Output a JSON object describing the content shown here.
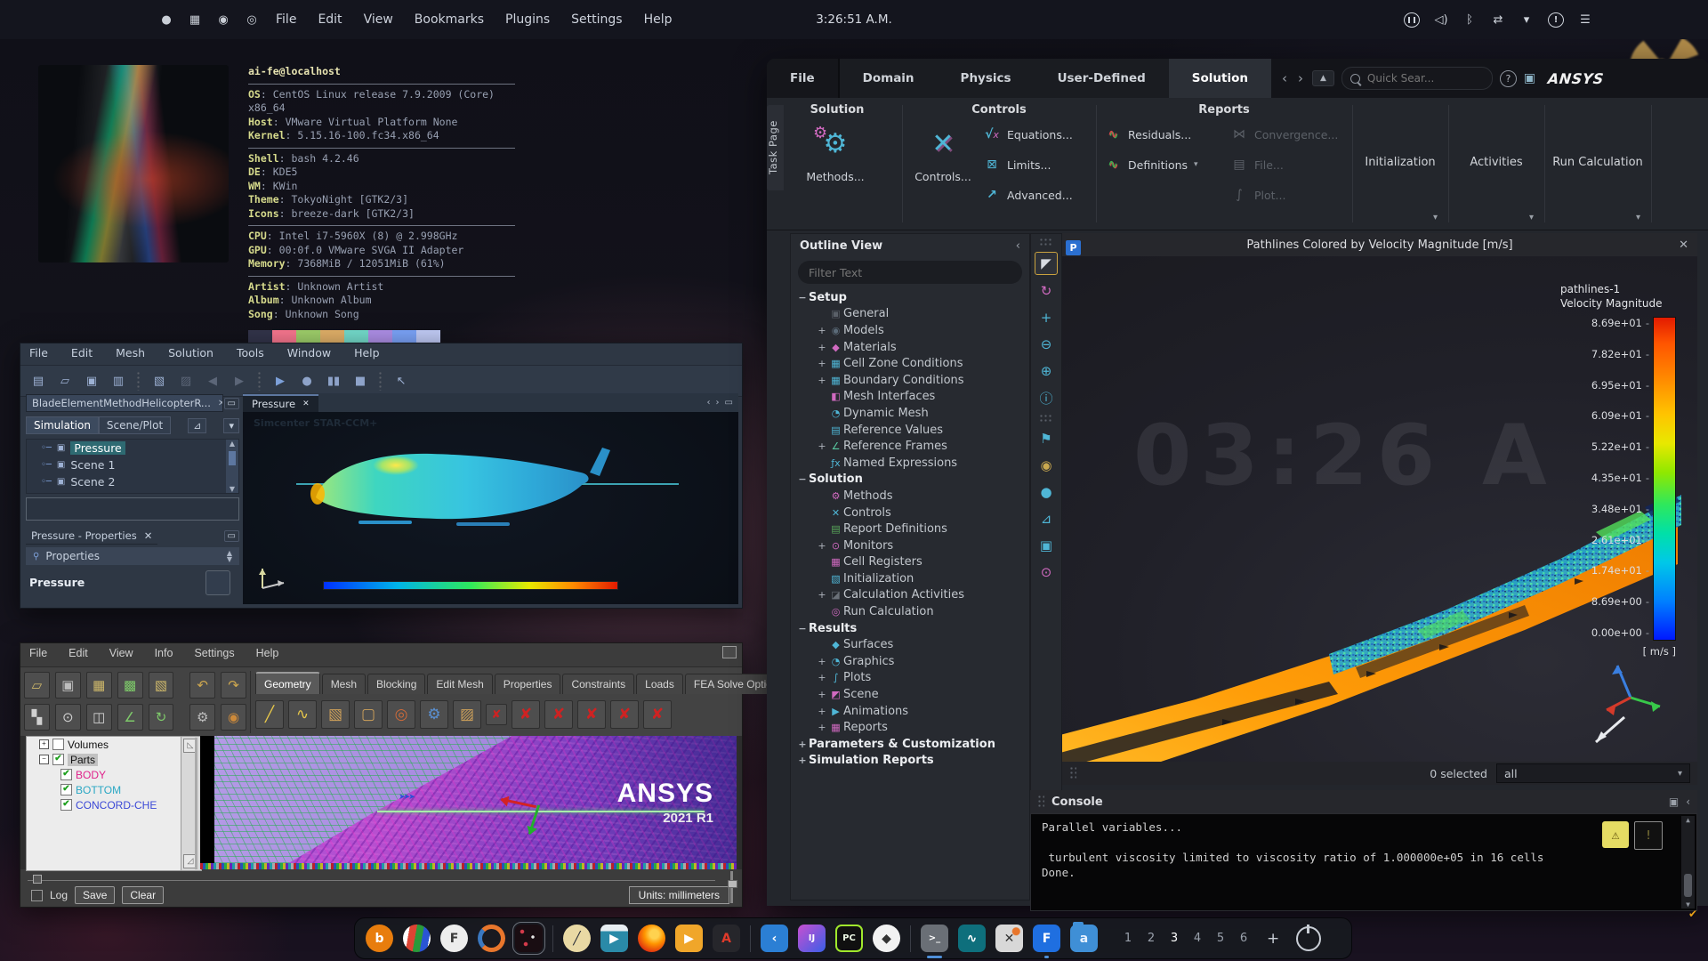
{
  "menubar": {
    "launchers": [
      {
        "n": "launcher-apps-icon",
        "g": "●"
      },
      {
        "n": "launcher-widgets-icon",
        "g": "▦"
      },
      {
        "n": "launcher-browser-icon",
        "g": "◉"
      },
      {
        "n": "launcher-settings-icon",
        "g": "◎"
      }
    ],
    "menus": [
      "File",
      "Edit",
      "View",
      "Bookmarks",
      "Plugins",
      "Settings",
      "Help"
    ],
    "time": "3:26:51 A.M.",
    "tray": [
      {
        "n": "media-pause-icon",
        "g": "",
        "cls": "tray-pause"
      },
      {
        "n": "volume-icon",
        "g": "◁)",
        "cls": ""
      },
      {
        "n": "bluetooth-icon",
        "g": "ᛒ",
        "cls": ""
      },
      {
        "n": "network-link-icon",
        "g": "⇄",
        "cls": ""
      },
      {
        "n": "tray-expand-icon",
        "g": "▾",
        "cls": ""
      },
      {
        "n": "notifications-icon",
        "g": "!",
        "cls": "tray-alert"
      },
      {
        "n": "panel-menu-icon",
        "g": "☰",
        "cls": ""
      }
    ]
  },
  "neofetch": {
    "host": "ai-fe@localhost",
    "groups": [
      [
        {
          "label": "OS",
          "value": "CentOS Linux release 7.9.2009 (Core) x86_64"
        },
        {
          "label": "Host",
          "value": "VMware Virtual Platform None"
        },
        {
          "label": "Kernel",
          "value": "5.15.16-100.fc34.x86_64"
        }
      ],
      [
        {
          "label": "Shell",
          "value": "bash 4.2.46"
        },
        {
          "label": "DE",
          "value": "KDE5"
        },
        {
          "label": "WM",
          "value": "KWin"
        },
        {
          "label": "Theme",
          "value": "TokyoNight [GTK2/3]"
        },
        {
          "label": "Icons",
          "value": "breeze-dark [GTK2/3]"
        }
      ],
      [
        {
          "label": "CPU",
          "value": "Intel i7-5960X (8) @ 2.998GHz"
        },
        {
          "label": "GPU",
          "value": "00:0f.0 VMware SVGA II Adapter"
        },
        {
          "label": "Memory",
          "value": "7368MiB / 12051MiB (61%)"
        }
      ],
      [
        {
          "label": "Artist",
          "value": "Unknown Artist"
        },
        {
          "label": "Album",
          "value": "Unknown Album"
        },
        {
          "label": "Song",
          "value": "Unknown Song"
        }
      ]
    ],
    "palette": [
      "#32344a",
      "#f7768e",
      "#9ece6a",
      "#e0af68",
      "#73daca",
      "#ad8ee6",
      "#7aa2f7",
      "#c0caf5"
    ]
  },
  "fluent": {
    "task_page": "Task Page",
    "tabs": [
      "File",
      "Domain",
      "Physics",
      "User-Defined",
      "Solution"
    ],
    "active_tab": "Solution",
    "search_placeholder": "Quick Sear...",
    "logo": "ANSYS",
    "ribbon": {
      "solution_title": "Solution",
      "methods": "Methods...",
      "controls_title": "Controls",
      "controls_big": "Controls...",
      "equations": "Equations...",
      "limits": "Limits...",
      "advanced": "Advanced...",
      "reports_title": "Reports",
      "residuals": "Residuals...",
      "definitions": "Definitions",
      "convergence": "Convergence...",
      "file": "File...",
      "plot": "Plot...",
      "init_group": "Initialization",
      "activities_group": "Activities",
      "run_group": "Run Calculation"
    },
    "outline": {
      "title": "Outline View",
      "filter_placeholder": "Filter Text",
      "items": [
        {
          "t": "Setup",
          "d": 0,
          "bold": true,
          "exp": "−"
        },
        {
          "t": "General",
          "d": 1,
          "icon": {
            "g": "▣",
            "c": "#5a6068"
          }
        },
        {
          "t": "Models",
          "d": 1,
          "exp": "+",
          "icon": {
            "g": "◉",
            "c": "#5a6a78"
          }
        },
        {
          "t": "Materials",
          "d": 1,
          "exp": "+",
          "icon": {
            "g": "◆",
            "c": "#d06ac0"
          }
        },
        {
          "t": "Cell Zone Conditions",
          "d": 1,
          "exp": "+",
          "icon": {
            "g": "▦",
            "c": "#4fb6d6"
          }
        },
        {
          "t": "Boundary Conditions",
          "d": 1,
          "exp": "+",
          "icon": {
            "g": "▦",
            "c": "#4fb6d6"
          }
        },
        {
          "t": "Mesh Interfaces",
          "d": 1,
          "icon": {
            "g": "◧",
            "c": "#d06ac0"
          }
        },
        {
          "t": "Dynamic Mesh",
          "d": 1,
          "icon": {
            "g": "◔",
            "c": "#4fb6d6"
          }
        },
        {
          "t": "Reference Values",
          "d": 1,
          "icon": {
            "g": "▤",
            "c": "#4fb6d6"
          }
        },
        {
          "t": "Reference Frames",
          "d": 1,
          "exp": "+",
          "icon": {
            "g": "∠",
            "c": "#58c8a0"
          }
        },
        {
          "t": "Named Expressions",
          "d": 1,
          "icon": {
            "g": "ƒx",
            "c": "#4fb6d6"
          }
        },
        {
          "t": "Solution",
          "d": 0,
          "bold": true,
          "exp": "−"
        },
        {
          "t": "Methods",
          "d": 1,
          "icon": {
            "g": "⚙",
            "c": "#d06ac0"
          }
        },
        {
          "t": "Controls",
          "d": 1,
          "icon": {
            "g": "✕",
            "c": "#4fb6d6"
          }
        },
        {
          "t": "Report Definitions",
          "d": 1,
          "icon": {
            "g": "▤",
            "c": "#58a85a"
          }
        },
        {
          "t": "Monitors",
          "d": 1,
          "exp": "+",
          "icon": {
            "g": "⊙",
            "c": "#d06ac0"
          }
        },
        {
          "t": "Cell Registers",
          "d": 1,
          "icon": {
            "g": "▦",
            "c": "#d06ac0"
          }
        },
        {
          "t": "Initialization",
          "d": 1,
          "icon": {
            "g": "▧",
            "c": "#4fb6d6"
          }
        },
        {
          "t": "Calculation Activities",
          "d": 1,
          "exp": "+",
          "icon": {
            "g": "◪",
            "c": "#6a7078"
          }
        },
        {
          "t": "Run Calculation",
          "d": 1,
          "icon": {
            "g": "◎",
            "c": "#d06ac0"
          }
        },
        {
          "t": "Results",
          "d": 0,
          "bold": true,
          "exp": "−"
        },
        {
          "t": "Surfaces",
          "d": 1,
          "icon": {
            "g": "◆",
            "c": "#4fb6d6"
          }
        },
        {
          "t": "Graphics",
          "d": 1,
          "exp": "+",
          "icon": {
            "g": "◔",
            "c": "#4fb6d6"
          }
        },
        {
          "t": "Plots",
          "d": 1,
          "exp": "+",
          "icon": {
            "g": "∫",
            "c": "#4fb6d6"
          }
        },
        {
          "t": "Scene",
          "d": 1,
          "exp": "+",
          "icon": {
            "g": "◩",
            "c": "#d06ac0"
          }
        },
        {
          "t": "Animations",
          "d": 1,
          "exp": "+",
          "icon": {
            "g": "▶",
            "c": "#4fb6d6"
          }
        },
        {
          "t": "Reports",
          "d": 1,
          "exp": "+",
          "icon": {
            "g": "▦",
            "c": "#d06ac0"
          }
        },
        {
          "t": "Parameters & Customization",
          "d": 0,
          "bold": true,
          "exp": "+"
        },
        {
          "t": "Simulation Reports",
          "d": 0,
          "bold": true,
          "exp": "+"
        }
      ]
    },
    "view_toolbar": [
      {
        "n": "select-pointer-tool",
        "g": "◤",
        "c": "#d8dce2",
        "sel": true
      },
      {
        "n": "rotate-view-tool",
        "g": "↻",
        "c": "#d06ac0"
      },
      {
        "n": "pan-tool",
        "g": "+",
        "c": "#4fb6d6"
      },
      {
        "n": "zoom-out-tool",
        "g": "⊖",
        "c": "#4fb6d6"
      },
      {
        "n": "zoom-in-tool",
        "g": "⊕",
        "c": "#4fb6d6"
      },
      {
        "n": "probe-info-tool",
        "g": "ⓘ",
        "c": "#4fb6d6"
      },
      {
        "n": "annotate-flag-tool",
        "g": "⚑",
        "c": "#4fb6d6"
      },
      {
        "n": "lights-tool",
        "g": "◉",
        "c": "#c9a84f"
      },
      {
        "n": "view-sphere-tool",
        "g": "●",
        "c": "#4fb6d6"
      },
      {
        "n": "axes-tool",
        "g": "⊿",
        "c": "#4fb6d6"
      },
      {
        "n": "copy-view-tool",
        "g": "▣",
        "c": "#4fb6d6"
      },
      {
        "n": "visibility-tool",
        "g": "⊙",
        "c": "#d06ac0"
      }
    ],
    "viewport": {
      "title": "Pathlines Colored by Velocity Magnitude [m/s]",
      "clock_watermark": "03:26 A",
      "p_badge": "P",
      "legend_name": "pathlines-1",
      "legend_title": "Velocity Magnitude",
      "legend_unit": "[ m/s ]",
      "ticks": [
        "8.69e+01",
        "7.82e+01",
        "6.95e+01",
        "6.09e+01",
        "5.22e+01",
        "4.35e+01",
        "3.48e+01",
        "2.61e+01",
        "1.74e+01",
        "8.69e+00",
        "0.00e+00"
      ],
      "selected": "0 selected",
      "scope": "all"
    },
    "console": {
      "title": "Console",
      "lines": [
        "Parallel variables...",
        "",
        " turbulent viscosity limited to viscosity ratio of 1.000000e+05 in 16 cells",
        "Done."
      ]
    }
  },
  "star": {
    "menus": [
      "File",
      "Edit",
      "Mesh",
      "Solution",
      "Tools",
      "Window",
      "Help"
    ],
    "toolbar": [
      {
        "n": "new-simulation",
        "g": "▤",
        "c": "#9db1d4"
      },
      {
        "n": "open-simulation",
        "g": "▱",
        "c": "#9db1d4"
      },
      {
        "n": "save-simulation",
        "g": "▣",
        "c": "#9db1d4"
      },
      {
        "n": "save-all",
        "g": "▥",
        "c": "#9db1d4"
      },
      {
        "n": "sep"
      },
      {
        "n": "copy",
        "g": "▧",
        "c": "#9db1d4"
      },
      {
        "n": "paste",
        "g": "▨",
        "c": "#5c6678"
      },
      {
        "n": "step-back",
        "g": "◀",
        "c": "#5c6678"
      },
      {
        "n": "step-forward",
        "g": "▶",
        "c": "#5c6678"
      },
      {
        "n": "sep"
      },
      {
        "n": "run-simulation",
        "g": "▶",
        "c": "#7da0d9"
      },
      {
        "n": "record",
        "g": "●",
        "c": "#8ea3c9"
      },
      {
        "n": "pause",
        "g": "▮▮",
        "c": "#8ea3c9"
      },
      {
        "n": "stop",
        "g": "■",
        "c": "#8ea3c9"
      },
      {
        "n": "sep"
      },
      {
        "n": "probe-select-tool",
        "g": "↖",
        "c": "#9db1d4"
      }
    ],
    "doc_tab": "BladeElementMethodHelicopterR...",
    "tabs": [
      "Simulation",
      "Scene/Plot"
    ],
    "active_tab": "Simulation",
    "tree": [
      "Pressure",
      "Scene 1",
      "Scene 2"
    ],
    "selected_item": "Pressure",
    "props_tab": "Pressure - Properties",
    "props_header": "Properties",
    "props_value": "Pressure",
    "view_tab": "Pressure",
    "watermark": "Simcenter STAR-CCM+"
  },
  "icem": {
    "menus": [
      "File",
      "Edit",
      "View",
      "Info",
      "Settings",
      "Help"
    ],
    "tabs": [
      "Geometry",
      "Mesh",
      "Blocking",
      "Edit Mesh",
      "Properties",
      "Constraints",
      "Loads",
      "FEA Solve Options"
    ],
    "active_tab": "Geometry",
    "toolbar_row1": [
      {
        "n": "open-project",
        "g": "▱",
        "c": "#cdb76a"
      },
      {
        "n": "save-project",
        "g": "▣",
        "c": "#bdbdbd"
      },
      {
        "n": "open-geometry",
        "g": "▦",
        "c": "#cdb76a"
      },
      {
        "n": "open-mesh",
        "g": "▩",
        "c": "#7ec96a"
      },
      {
        "n": "import-model",
        "g": "▧",
        "c": "#cdb76a"
      },
      {
        "n": "sep"
      },
      {
        "n": "undo",
        "g": "↶",
        "c": "#cfa84f"
      },
      {
        "n": "redo",
        "g": "↷",
        "c": "#cfa84f"
      }
    ],
    "toolbar_row2": [
      {
        "n": "fit-window",
        "g": "▚",
        "c": "#d0d0d0"
      },
      {
        "n": "zoom-window",
        "g": "⊙",
        "c": "#d0d0d0"
      },
      {
        "n": "local-coords",
        "g": "◫",
        "c": "#d0d0d0"
      },
      {
        "n": "measure-tool",
        "g": "∠",
        "c": "#7ec96a"
      },
      {
        "n": "refresh-view",
        "g": "↻",
        "c": "#7ec96a"
      },
      {
        "n": "sep"
      },
      {
        "n": "settings-gears",
        "g": "⚙",
        "c": "#bdbdbd"
      },
      {
        "n": "material-barrel",
        "g": "◉",
        "c": "#cd8a3a"
      }
    ],
    "tools": [
      {
        "n": "create-point-tool",
        "g": "╱",
        "c": "#e8c84a"
      },
      {
        "n": "create-curve-tool",
        "g": "∿",
        "c": "#e8c84a"
      },
      {
        "n": "create-surface-tool",
        "g": "▧",
        "c": "#cda05a"
      },
      {
        "n": "create-body-tool",
        "g": "▢",
        "c": "#cda05a"
      },
      {
        "n": "repair-geometry-tool",
        "g": "◎",
        "c": "#cd6a3a"
      },
      {
        "n": "transform-tool",
        "g": "⚙",
        "c": "#5a8fd0"
      },
      {
        "n": "translate-tool",
        "g": "▨",
        "c": "#cda05a"
      },
      {
        "n": "delete-point-tool",
        "g": "✘",
        "c": "#cf2222",
        "sm": true
      },
      {
        "n": "delete-curve-tool",
        "g": "✘",
        "c": "#cf2222"
      },
      {
        "n": "delete-surface-tool",
        "g": "✘",
        "c": "#cf2222"
      },
      {
        "n": "delete-body-tool",
        "g": "✘",
        "c": "#cf2222"
      },
      {
        "n": "delete-entity-tool",
        "g": "✘",
        "c": "#cf2222"
      },
      {
        "n": "delete-all-tool",
        "g": "✘",
        "c": "#cf2222"
      }
    ],
    "tree": [
      {
        "label": "Volumes",
        "color": "#111111",
        "check": "empty",
        "exp": "+",
        "d": 0
      },
      {
        "label": "Parts",
        "color": "#111111",
        "check": "checked",
        "exp": "−",
        "d": 0,
        "hl": true
      },
      {
        "label": "BODY",
        "color": "#e0218a",
        "check": "checked",
        "d": 1
      },
      {
        "label": "BOTTOM",
        "color": "#2aa7c4",
        "check": "checked",
        "d": 1
      },
      {
        "label": "CONCORD-CHE",
        "color": "#3b48d6",
        "check": "checked",
        "d": 1
      }
    ],
    "log_label": "Log",
    "save": "Save",
    "clear": "Clear",
    "units": "Units: millimeters",
    "watermark1": "ANSYS",
    "watermark2": "2021 R1"
  },
  "taskbar": {
    "apps": [
      {
        "n": "blender",
        "ch": "b",
        "cls": "tb-circle",
        "bg": "#e87d0d",
        "fg": "#fff"
      },
      {
        "n": "media-stripes",
        "ch": "",
        "cls": "tb-circle tb-stripes",
        "bg": "",
        "fg": ""
      },
      {
        "n": "f-engineering-app",
        "ch": "F",
        "cls": "tb-circle",
        "bg": "#ededed",
        "fg": "#3a3a3a"
      },
      {
        "n": "ring-app",
        "ch": "",
        "cls": "tb-ring",
        "bg": "",
        "fg": ""
      },
      {
        "n": "particle-nodes-app",
        "ch": "",
        "cls": "tb-dots tb-selected",
        "bg": "",
        "fg": ""
      },
      {
        "n": "sep"
      },
      {
        "n": "krita",
        "ch": "╱",
        "cls": "tb-circle",
        "bg": "#e9d9a4",
        "fg": "#2a2f3a"
      },
      {
        "n": "kdenlive",
        "ch": "▶",
        "cls": "tb-clapper",
        "bg": "",
        "fg": "#fff"
      },
      {
        "n": "firefox",
        "ch": "",
        "cls": "tb-circle tb-firefox",
        "bg": "",
        "fg": ""
      },
      {
        "n": "media-player",
        "ch": "▶",
        "cls": "",
        "bg": "#f0a62a",
        "fg": "#fff"
      },
      {
        "n": "acrobat-reader",
        "ch": "A",
        "cls": "",
        "bg": "#26262b",
        "fg": "#e03a2a"
      },
      {
        "n": "sep"
      },
      {
        "n": "vscode",
        "ch": "‹",
        "cls": "",
        "bg": "#2b7fd4",
        "fg": "#fff"
      },
      {
        "n": "intellij-idea",
        "ch": "IJ",
        "cls": "tb-ij",
        "bg": "",
        "fg": "#fff"
      },
      {
        "n": "pycharm",
        "ch": "PC",
        "cls": "tb-pc",
        "bg": "#101010",
        "fg": "#eaf6e2"
      },
      {
        "n": "assistant-app",
        "ch": "◆",
        "cls": "tb-circle",
        "bg": "#f2f2f2",
        "fg": "#333"
      },
      {
        "n": "sep"
      },
      {
        "n": "terminal",
        "ch": ">_",
        "cls": "",
        "bg": "#6a6f76",
        "fg": "#fff",
        "run": "bar"
      },
      {
        "n": "plot-tool-app",
        "ch": "∿",
        "cls": "",
        "bg": "#0e6f7c",
        "fg": "#fff"
      },
      {
        "n": "x-server-app",
        "ch": "✕",
        "cls": "tb-xapp",
        "bg": "",
        "fg": "#333"
      },
      {
        "n": "ansys-fluent",
        "ch": "F",
        "cls": "",
        "bg": "#1f6fe0",
        "fg": "#fff",
        "run": "dot"
      },
      {
        "n": "file-manager",
        "ch": "a",
        "cls": "tb-folder",
        "bg": "#3f8fd6",
        "fg": "#e8f2ff"
      }
    ],
    "workspaces": [
      "1",
      "2",
      "3",
      "4",
      "5",
      "6"
    ],
    "active_workspace": "3",
    "plus": "+"
  }
}
